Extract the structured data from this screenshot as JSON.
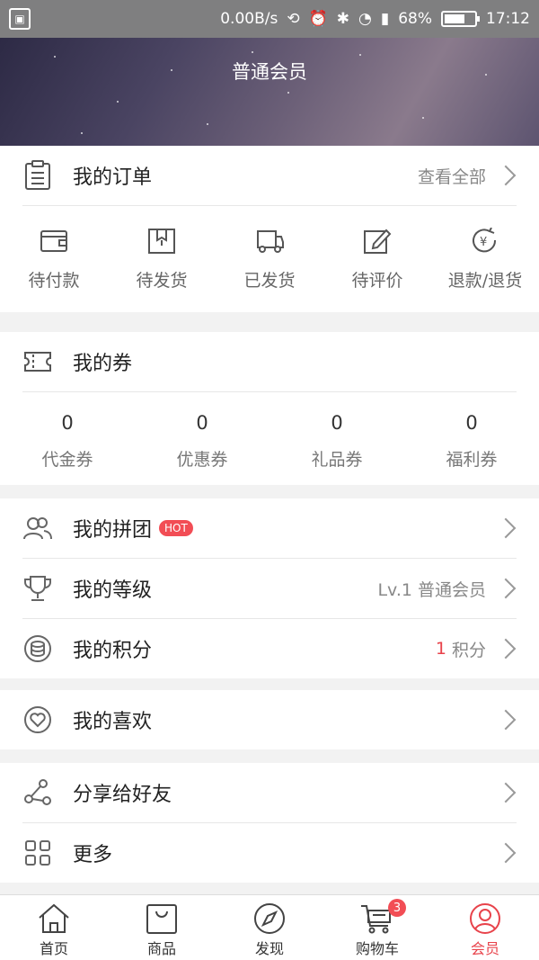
{
  "status_bar": {
    "network_speed": "0.00B/s",
    "battery_percent": "68%",
    "battery_level": 0.68,
    "time": "17:12"
  },
  "header": {
    "title": "普通会员"
  },
  "orders": {
    "title": "我的订单",
    "view_all": "查看全部",
    "items": [
      {
        "label": "待付款",
        "icon": "wallet-icon"
      },
      {
        "label": "待发货",
        "icon": "box-icon"
      },
      {
        "label": "已发货",
        "icon": "truck-icon"
      },
      {
        "label": "待评价",
        "icon": "edit-icon"
      },
      {
        "label": "退款/退货",
        "icon": "refund-icon"
      }
    ]
  },
  "coupons": {
    "title": "我的券",
    "items": [
      {
        "count": "0",
        "label": "代金券"
      },
      {
        "count": "0",
        "label": "优惠券"
      },
      {
        "count": "0",
        "label": "礼品券"
      },
      {
        "count": "0",
        "label": "福利券"
      }
    ]
  },
  "menu": {
    "group_buy": {
      "label": "我的拼团",
      "badge": "HOT"
    },
    "level": {
      "label": "我的等级",
      "value": "Lv.1 普通会员"
    },
    "points": {
      "label": "我的积分",
      "value": "1",
      "unit": "积分"
    },
    "favorites": {
      "label": "我的喜欢"
    },
    "share": {
      "label": "分享给好友"
    },
    "more": {
      "label": "更多"
    }
  },
  "tabbar": {
    "items": [
      {
        "label": "首页",
        "icon": "home-icon"
      },
      {
        "label": "商品",
        "icon": "bag-icon"
      },
      {
        "label": "发现",
        "icon": "compass-icon"
      },
      {
        "label": "购物车",
        "icon": "cart-icon",
        "badge": "3"
      },
      {
        "label": "会员",
        "icon": "member-icon"
      }
    ],
    "active": "会员"
  },
  "colors": {
    "accent": "#e8434b"
  }
}
